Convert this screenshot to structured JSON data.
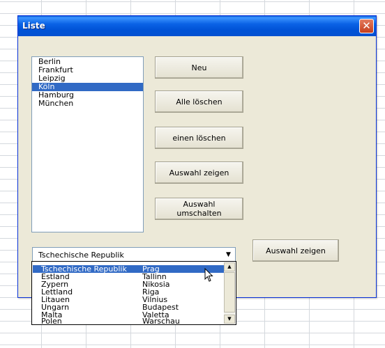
{
  "window": {
    "title": "Liste",
    "close_glyph": "✕"
  },
  "listbox": {
    "items": [
      "Berlin",
      "Frankfurt",
      "Leipzig",
      "Köln",
      "Hamburg",
      "München"
    ],
    "selected_index": 3
  },
  "buttons": {
    "new": "Neu",
    "delete_all": "Alle löschen",
    "delete_one": "einen löschen",
    "show_selection": "Auswahl zeigen",
    "toggle_selection": "Auswahl umschalten",
    "show_selection_2": "Auswahl zeigen"
  },
  "combo": {
    "value": "Tschechische Republik",
    "arrow_icon": "chevron-down-icon",
    "options": [
      {
        "country": "Tschechische Republik",
        "capital": "Prag"
      },
      {
        "country": "Estland",
        "capital": "Tallinn"
      },
      {
        "country": "Zypern",
        "capital": "Nikosia"
      },
      {
        "country": "Lettland",
        "capital": "Riga"
      },
      {
        "country": "Litauen",
        "capital": "Vilnius"
      },
      {
        "country": "Ungarn",
        "capital": "Budapest"
      },
      {
        "country": "Malta",
        "capital": "Valetta"
      },
      {
        "country": "Polen",
        "capital": "Warschau"
      }
    ],
    "selected_index": 0
  },
  "colors": {
    "selection": "#316ac5",
    "dialog_bg": "#ece9d8",
    "titlebar": "#0a62e5",
    "close": "#c63e1c"
  }
}
